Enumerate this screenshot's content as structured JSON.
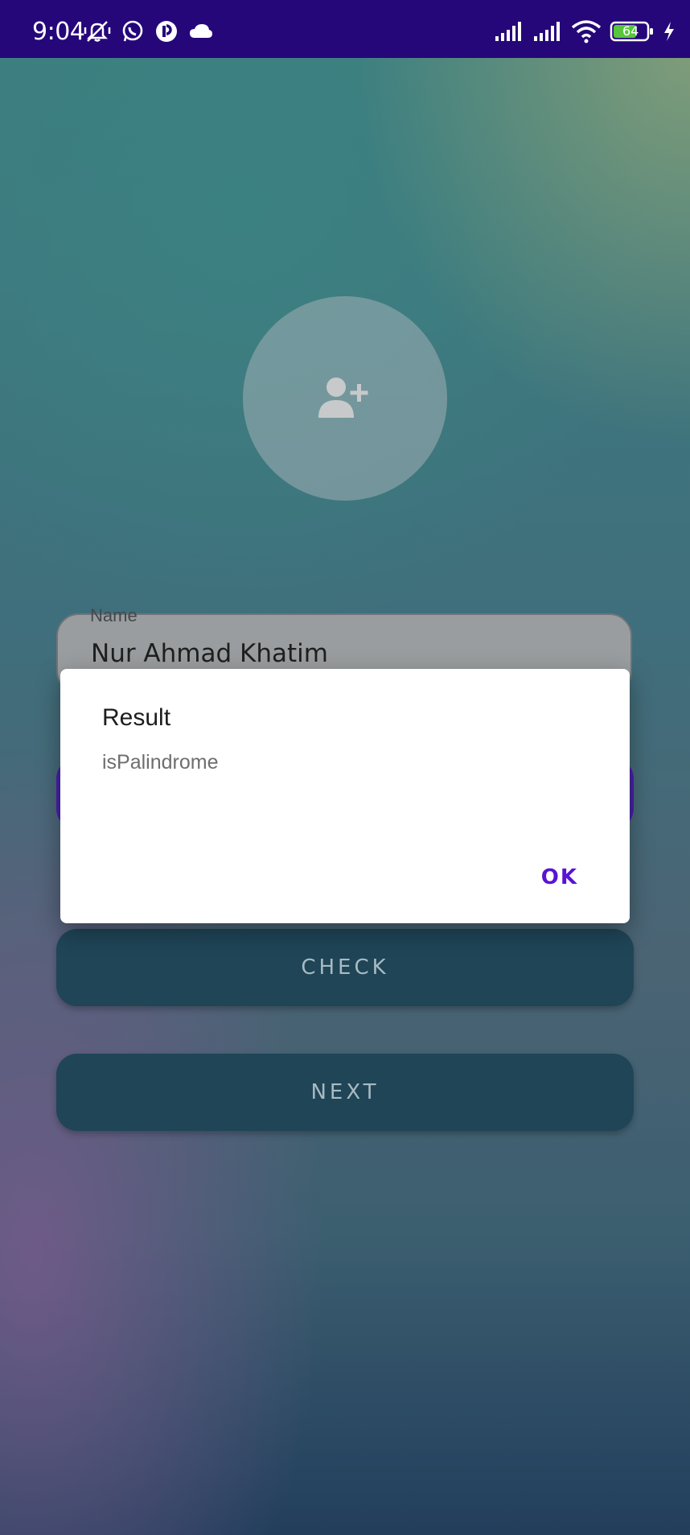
{
  "status_bar": {
    "time": "9:04",
    "battery_level": "64",
    "icons_left": [
      "mute-vibrate-icon",
      "whatsapp-icon",
      "app-notification-icon",
      "cloud-icon"
    ],
    "icons_right": [
      "signal-icon",
      "signal-icon",
      "wifi-icon",
      "battery-icon",
      "charging-icon"
    ]
  },
  "avatar": {
    "icon": "add-user-icon"
  },
  "name_field": {
    "label": "Name",
    "value": "Nur Ahmad Khatim"
  },
  "buttons": {
    "check_label": "CHECK",
    "next_label": "NEXT"
  },
  "dialog": {
    "title": "Result",
    "message": "isPalindrome",
    "ok_label": "OK"
  },
  "colors": {
    "status_bar": "#25077a",
    "button_bg": "#1f4557",
    "accent": "#5a12d4"
  }
}
